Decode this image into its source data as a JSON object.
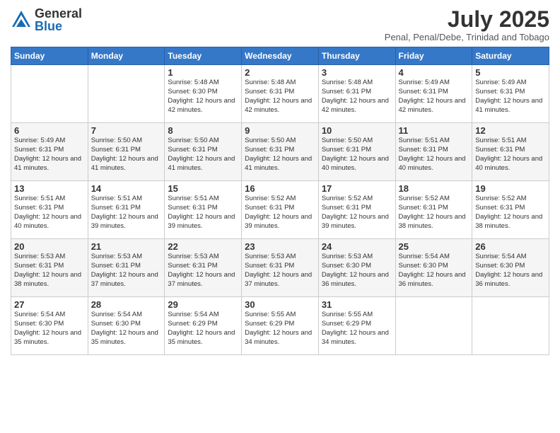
{
  "header": {
    "logo_general": "General",
    "logo_blue": "Blue",
    "month_title": "July 2025",
    "subtitle": "Penal, Penal/Debe, Trinidad and Tobago"
  },
  "days_of_week": [
    "Sunday",
    "Monday",
    "Tuesday",
    "Wednesday",
    "Thursday",
    "Friday",
    "Saturday"
  ],
  "weeks": [
    [
      {
        "day": "",
        "info": ""
      },
      {
        "day": "",
        "info": ""
      },
      {
        "day": "1",
        "info": "Sunrise: 5:48 AM\nSunset: 6:30 PM\nDaylight: 12 hours and 42 minutes."
      },
      {
        "day": "2",
        "info": "Sunrise: 5:48 AM\nSunset: 6:31 PM\nDaylight: 12 hours and 42 minutes."
      },
      {
        "day": "3",
        "info": "Sunrise: 5:48 AM\nSunset: 6:31 PM\nDaylight: 12 hours and 42 minutes."
      },
      {
        "day": "4",
        "info": "Sunrise: 5:49 AM\nSunset: 6:31 PM\nDaylight: 12 hours and 42 minutes."
      },
      {
        "day": "5",
        "info": "Sunrise: 5:49 AM\nSunset: 6:31 PM\nDaylight: 12 hours and 41 minutes."
      }
    ],
    [
      {
        "day": "6",
        "info": "Sunrise: 5:49 AM\nSunset: 6:31 PM\nDaylight: 12 hours and 41 minutes."
      },
      {
        "day": "7",
        "info": "Sunrise: 5:50 AM\nSunset: 6:31 PM\nDaylight: 12 hours and 41 minutes."
      },
      {
        "day": "8",
        "info": "Sunrise: 5:50 AM\nSunset: 6:31 PM\nDaylight: 12 hours and 41 minutes."
      },
      {
        "day": "9",
        "info": "Sunrise: 5:50 AM\nSunset: 6:31 PM\nDaylight: 12 hours and 41 minutes."
      },
      {
        "day": "10",
        "info": "Sunrise: 5:50 AM\nSunset: 6:31 PM\nDaylight: 12 hours and 40 minutes."
      },
      {
        "day": "11",
        "info": "Sunrise: 5:51 AM\nSunset: 6:31 PM\nDaylight: 12 hours and 40 minutes."
      },
      {
        "day": "12",
        "info": "Sunrise: 5:51 AM\nSunset: 6:31 PM\nDaylight: 12 hours and 40 minutes."
      }
    ],
    [
      {
        "day": "13",
        "info": "Sunrise: 5:51 AM\nSunset: 6:31 PM\nDaylight: 12 hours and 40 minutes."
      },
      {
        "day": "14",
        "info": "Sunrise: 5:51 AM\nSunset: 6:31 PM\nDaylight: 12 hours and 39 minutes."
      },
      {
        "day": "15",
        "info": "Sunrise: 5:51 AM\nSunset: 6:31 PM\nDaylight: 12 hours and 39 minutes."
      },
      {
        "day": "16",
        "info": "Sunrise: 5:52 AM\nSunset: 6:31 PM\nDaylight: 12 hours and 39 minutes."
      },
      {
        "day": "17",
        "info": "Sunrise: 5:52 AM\nSunset: 6:31 PM\nDaylight: 12 hours and 39 minutes."
      },
      {
        "day": "18",
        "info": "Sunrise: 5:52 AM\nSunset: 6:31 PM\nDaylight: 12 hours and 38 minutes."
      },
      {
        "day": "19",
        "info": "Sunrise: 5:52 AM\nSunset: 6:31 PM\nDaylight: 12 hours and 38 minutes."
      }
    ],
    [
      {
        "day": "20",
        "info": "Sunrise: 5:53 AM\nSunset: 6:31 PM\nDaylight: 12 hours and 38 minutes."
      },
      {
        "day": "21",
        "info": "Sunrise: 5:53 AM\nSunset: 6:31 PM\nDaylight: 12 hours and 37 minutes."
      },
      {
        "day": "22",
        "info": "Sunrise: 5:53 AM\nSunset: 6:31 PM\nDaylight: 12 hours and 37 minutes."
      },
      {
        "day": "23",
        "info": "Sunrise: 5:53 AM\nSunset: 6:31 PM\nDaylight: 12 hours and 37 minutes."
      },
      {
        "day": "24",
        "info": "Sunrise: 5:53 AM\nSunset: 6:30 PM\nDaylight: 12 hours and 36 minutes."
      },
      {
        "day": "25",
        "info": "Sunrise: 5:54 AM\nSunset: 6:30 PM\nDaylight: 12 hours and 36 minutes."
      },
      {
        "day": "26",
        "info": "Sunrise: 5:54 AM\nSunset: 6:30 PM\nDaylight: 12 hours and 36 minutes."
      }
    ],
    [
      {
        "day": "27",
        "info": "Sunrise: 5:54 AM\nSunset: 6:30 PM\nDaylight: 12 hours and 35 minutes."
      },
      {
        "day": "28",
        "info": "Sunrise: 5:54 AM\nSunset: 6:30 PM\nDaylight: 12 hours and 35 minutes."
      },
      {
        "day": "29",
        "info": "Sunrise: 5:54 AM\nSunset: 6:29 PM\nDaylight: 12 hours and 35 minutes."
      },
      {
        "day": "30",
        "info": "Sunrise: 5:55 AM\nSunset: 6:29 PM\nDaylight: 12 hours and 34 minutes."
      },
      {
        "day": "31",
        "info": "Sunrise: 5:55 AM\nSunset: 6:29 PM\nDaylight: 12 hours and 34 minutes."
      },
      {
        "day": "",
        "info": ""
      },
      {
        "day": "",
        "info": ""
      }
    ]
  ]
}
